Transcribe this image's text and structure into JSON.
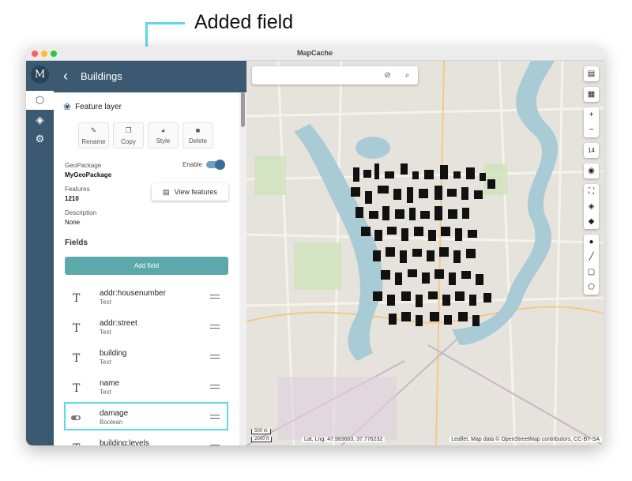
{
  "annotation": {
    "text": "Added field",
    "color": "#5fd9e4"
  },
  "window": {
    "title": "MapCache"
  },
  "rail": {
    "logo": "M",
    "items": [
      "cube-icon",
      "layers-icon",
      "settings-icon"
    ]
  },
  "drawer": {
    "title": "Buildings",
    "layer_type": "Feature layer",
    "actions": {
      "rename": "Rename",
      "copy": "Copy",
      "style": "Style",
      "delete": "Delete"
    },
    "geopackage_label": "GeoPackage",
    "geopackage_value": "MyGeoPackage",
    "enable_label": "Enable",
    "enabled": true,
    "features_label": "Features",
    "features_value": "1210",
    "view_features": "View features",
    "description_label": "Description",
    "description_value": "None",
    "fields_title": "Fields",
    "add_field": "Add field",
    "fields": [
      {
        "name": "addr:housenumber",
        "type": "Text"
      },
      {
        "name": "addr:street",
        "type": "Text"
      },
      {
        "name": "building",
        "type": "Text"
      },
      {
        "name": "name",
        "type": "Text"
      },
      {
        "name": "damage",
        "type": "Boolean"
      },
      {
        "name": "building:levels",
        "type": ""
      }
    ]
  },
  "map": {
    "search_placeholder": "",
    "zoom_level": "14",
    "scale_metric": "500 m",
    "scale_imperial": "2000 ft",
    "coordinates": "Lat, Lng: 47.983603, 37.776232",
    "attribution": "Leaflet, Map data © OpenStreetMap contributors, CC-BY-SA",
    "accent_color": "#3b5a72",
    "water_color": "#a9cbd6"
  }
}
